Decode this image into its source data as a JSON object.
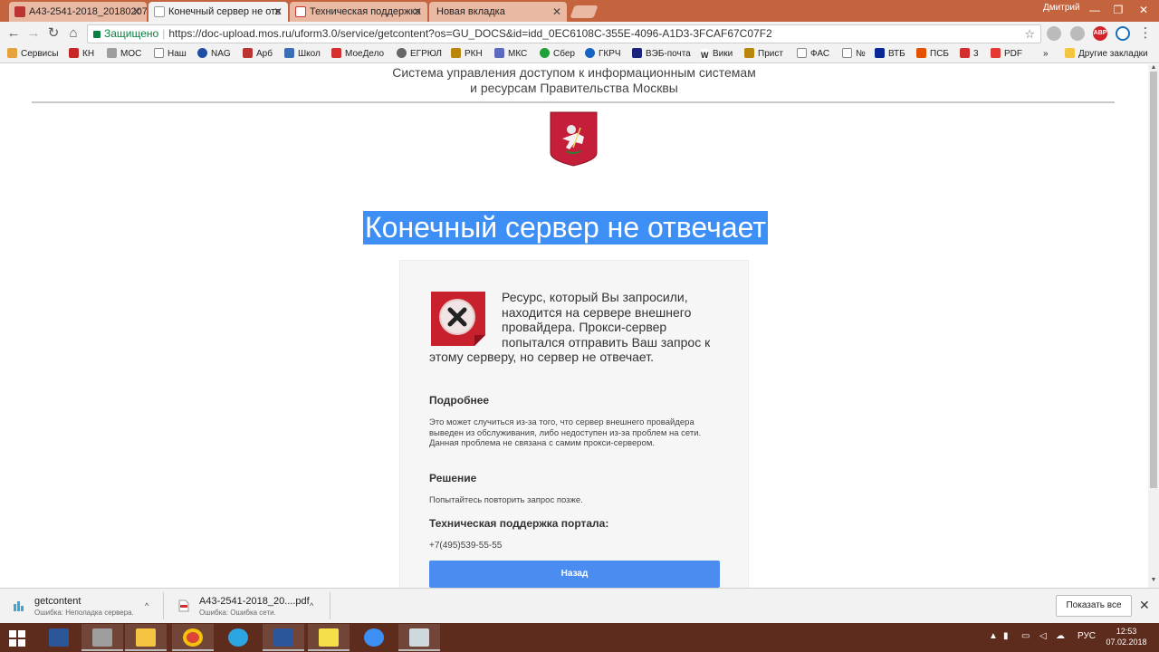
{
  "browser": {
    "tabs": [
      {
        "label": "A43-2541-2018_20180207"
      },
      {
        "label": "Конечный сервер не отв"
      },
      {
        "label": "Техническая поддержка"
      },
      {
        "label": "Новая вкладка"
      }
    ],
    "user_name": "Дмитрий",
    "window_controls": {
      "minimize": "—",
      "maximize": "❐",
      "close": "✕"
    },
    "security_label": "Защищено",
    "url_host": "https://doc-upload.mos.ru",
    "url_path": "/uform3.0/service/getcontent?os=GU_DOCS&id=idd_0EC6108C-355E-4096-A1D3-3FCAF67C07F2",
    "extension_abp": "ABP"
  },
  "bookmarks": {
    "items": [
      "Сервисы",
      "КН",
      "МОС",
      "Наш",
      "NAG",
      "Арб",
      "Школ",
      "МоеДело",
      "ЕГРЮЛ",
      "РКН",
      "МКС",
      "Сбер",
      "ГКРЧ",
      "ВЭБ-почта",
      "Вики",
      "Прист",
      "ФАС",
      "№",
      "ВТБ",
      "ПСБ",
      "3",
      "PDF"
    ],
    "overflow": "»",
    "other": "Другие закладки"
  },
  "page": {
    "system_title_line1": "Система управления доступом к информационным системам",
    "system_title_line2": "и ресурсам Правительства Москвы",
    "headline": "Конечный сервер не отвечает",
    "intro": "Ресурс, который Вы запросили, находится на сервере внешнего провайдера. Прокси-сервер попытался отправить Ваш запрос к этому серверу, но сервер не отвечает.",
    "details_heading": "Подробнее",
    "details_text": "Это может случиться из-за того, что сервер внешнего провайдера выведен из обслуживания, либо недоступен из-за проблем на сети. Данная проблема не связана с самим прокси-сервером.",
    "solution_heading": "Решение",
    "solution_text": "Попытайтесь повторить запрос позже.",
    "support_heading": "Техническая поддержка портала:",
    "support_phone": "+7(495)539-55-55",
    "back_button": "Назад"
  },
  "downloads": {
    "items": [
      {
        "name": "getcontent",
        "status": "Ошибка: Неполадка сервера."
      },
      {
        "name": "A43-2541-2018_20....pdf",
        "status": "Ошибка: Ошибка сети."
      }
    ],
    "show_all": "Показать все"
  },
  "taskbar": {
    "language": "РУС",
    "time": "12:53",
    "date": "07.02.2018"
  },
  "colors": {
    "headline_highlight": "#3d8ef5",
    "back_button": "#4b8cf0",
    "error_icon": "#c8202d",
    "tabstrip": "#c4643e",
    "taskbar": "#5e2c1c"
  }
}
